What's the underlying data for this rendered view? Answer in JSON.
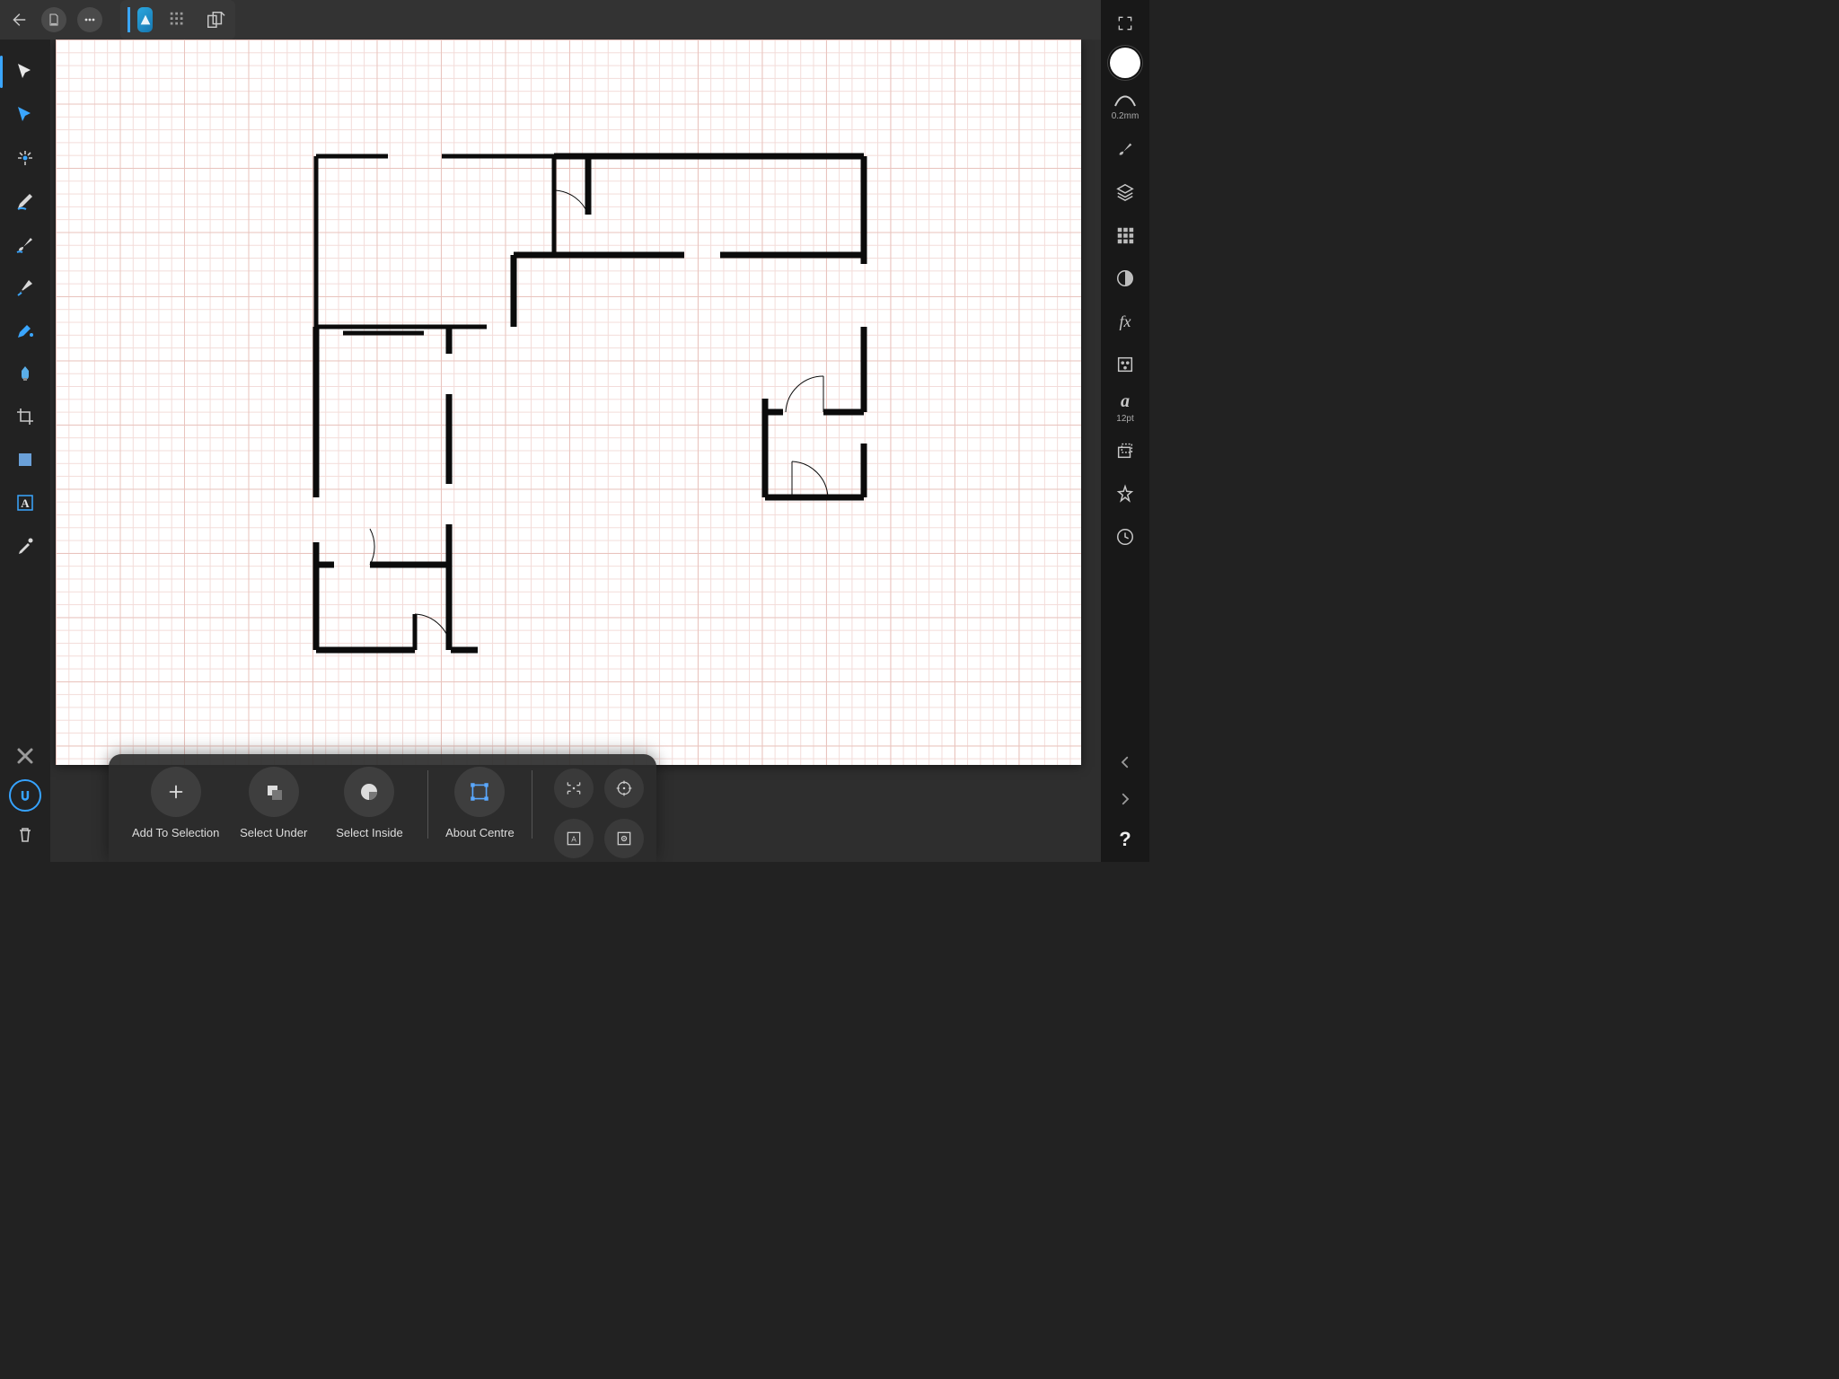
{
  "right_panel": {
    "stroke_width_label": "0.2mm",
    "char_style_size": "12pt"
  },
  "context_bar": {
    "items": [
      {
        "label": "Add To Selection"
      },
      {
        "label": "Select Under"
      },
      {
        "label": "Select Inside"
      },
      {
        "label": "About Centre"
      }
    ]
  }
}
